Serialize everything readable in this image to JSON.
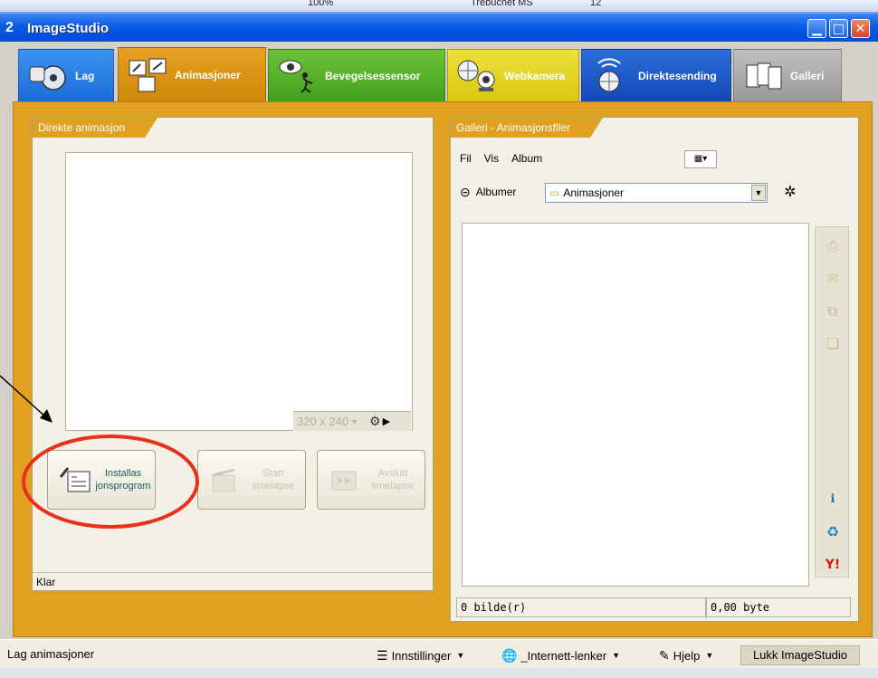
{
  "top_strip": {
    "zoom": "100%",
    "font_name": "Trebuchet MS",
    "font_size": "12"
  },
  "window": {
    "title": "ImageStudio",
    "icon_glyph": "2"
  },
  "tabs": [
    {
      "label": "Lag"
    },
    {
      "label": "Animasjoner"
    },
    {
      "label": "Bevegelsessensor"
    },
    {
      "label": "Webkamera"
    },
    {
      "label": "Direktesending"
    },
    {
      "label": "Galleri"
    }
  ],
  "left_panel": {
    "title": "Direkte animasjon",
    "resolution": "320 x 240",
    "buttons": [
      {
        "label_line1": "Installas",
        "label_line2": "jonsprogram",
        "state": "enabled"
      },
      {
        "label_line1": "Start",
        "label_line2": "timelapse",
        "state": "disabled"
      },
      {
        "label_line1": "Avslutt",
        "label_line2": "timelapse",
        "state": "disabled"
      }
    ],
    "status": "Klar"
  },
  "right_panel": {
    "title": "Galleri - Animasjonsfiler",
    "menu": [
      "Fil",
      "Vis",
      "Album"
    ],
    "albums_label": "Albumer",
    "album_selected": "Animasjoner",
    "status_count": "0 bilde(r)",
    "status_size": "0,00 byte",
    "side_tools": [
      "print-icon",
      "email-icon",
      "copy-icon",
      "stack-icon",
      "im-icon",
      "share-icon",
      "yahoo-icon"
    ]
  },
  "bottom_bar": {
    "status": "Lag animasjoner",
    "settings": "Innstillinger",
    "internet_links": "_Internett-lenker",
    "help": "Hjelp",
    "close": "Lukk ImageStudio"
  },
  "colors": {
    "accent_orange": "#e0a022",
    "titlebar_blue": "#0a5ce6",
    "annotation_red": "#e8311a"
  }
}
